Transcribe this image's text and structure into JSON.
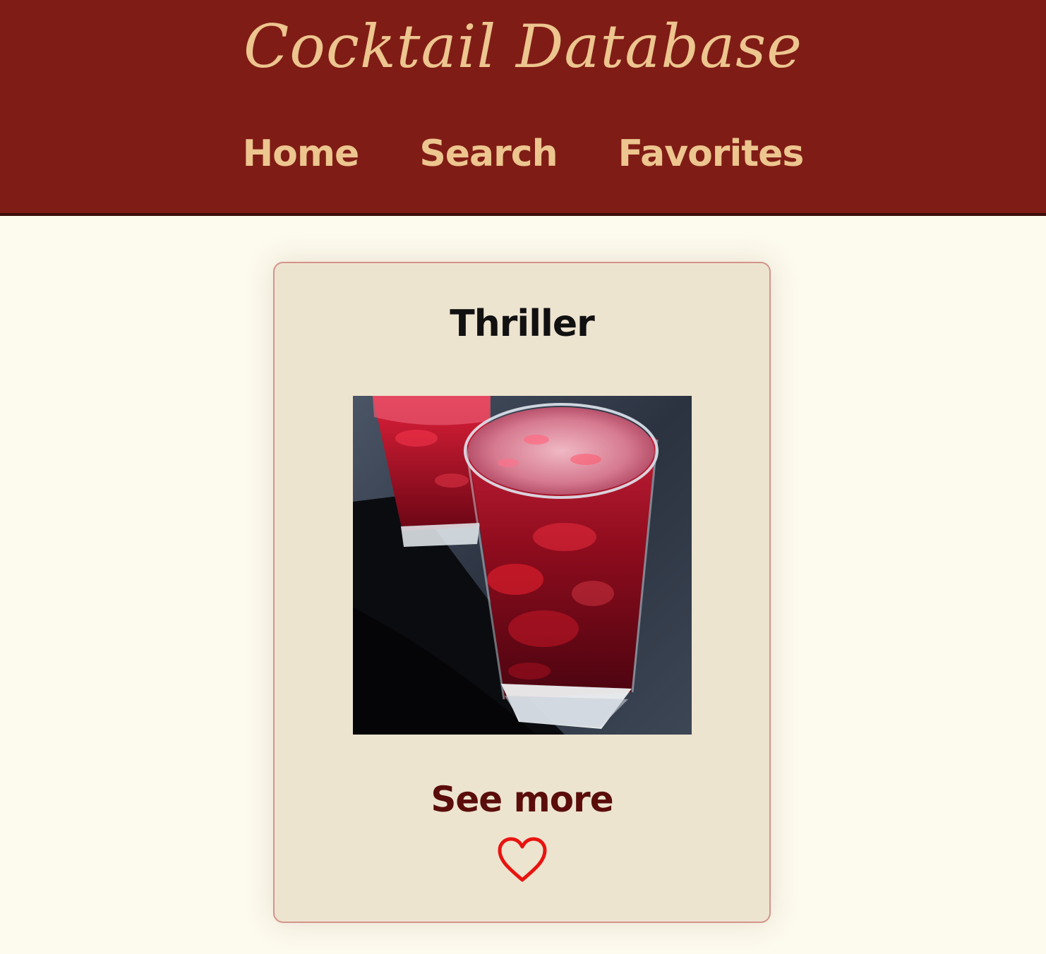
{
  "header": {
    "title": "Cocktail Database",
    "nav": [
      {
        "label": "Home"
      },
      {
        "label": "Search"
      },
      {
        "label": "Favorites"
      }
    ]
  },
  "card": {
    "title": "Thriller",
    "image_alt": "Thriller cocktail",
    "see_more_label": "See more",
    "favorite_icon": "heart-outline-icon"
  },
  "colors": {
    "header_bg": "#801c16",
    "header_text": "#edc58f",
    "page_bg": "#fdfaee",
    "card_bg": "#ede4d0",
    "card_border": "#d4948a",
    "link_dark_red": "#5a0d0a",
    "heart_red": "#e8140f"
  }
}
